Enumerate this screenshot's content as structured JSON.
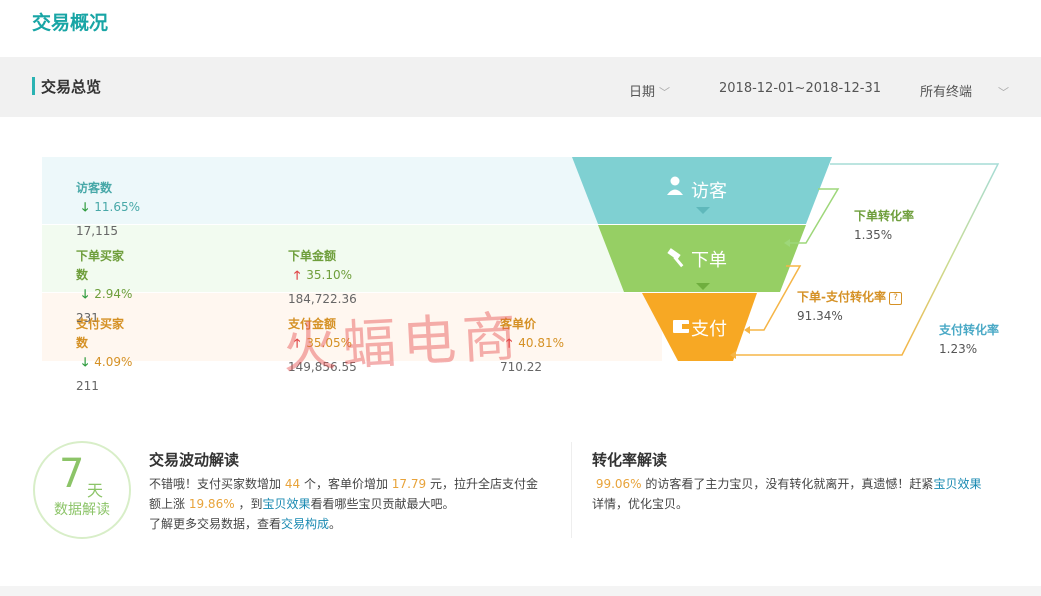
{
  "page": {
    "title": "交易概况"
  },
  "overview": {
    "title": "交易总览",
    "filters": {
      "date_label": "日期",
      "date_range": "2018-12-01~2018-12-31",
      "terminal": "所有终端"
    }
  },
  "metrics": {
    "visitors": {
      "label": "访客数",
      "trend": "down",
      "change": "11.65%",
      "value": "17,115"
    },
    "order_buyers": {
      "label": "下单买家数",
      "trend": "down",
      "change": "2.94%",
      "value": "231"
    },
    "order_amount": {
      "label": "下单金额",
      "trend": "up",
      "change": "35.10%",
      "value": "184,722.36"
    },
    "pay_buyers": {
      "label": "支付买家数",
      "trend": "down",
      "change": "4.09%",
      "value": "211"
    },
    "pay_amount": {
      "label": "支付金额",
      "trend": "up",
      "change": "35.05%",
      "value": "149,856.55"
    },
    "unit_price": {
      "label": "客单价",
      "trend": "up",
      "change": "40.81%",
      "value": "710.22"
    }
  },
  "funnel": {
    "stages": [
      {
        "name": "访客",
        "icon": "user-icon",
        "color": "#7fd0d2"
      },
      {
        "name": "下单",
        "icon": "gavel-icon",
        "color": "#96cf64"
      },
      {
        "name": "支付",
        "icon": "wallet-icon",
        "color": "#f7a824"
      }
    ],
    "rates": {
      "order_rate": {
        "name": "下单转化率",
        "value": "1.35%"
      },
      "order_pay_rate": {
        "name": "下单-支付转化率",
        "value": "91.34%"
      },
      "pay_rate": {
        "name": "支付转化率",
        "value": "1.23%"
      }
    }
  },
  "watermark": "火蝠电商",
  "badge": {
    "days": "7",
    "unit": "天",
    "caption": "数据解读"
  },
  "fluctuation": {
    "title": "交易波动解读",
    "p1_a": "不错哦！支付买家数增加",
    "p1_b": "44",
    "p1_c": "个，客单价增加",
    "p1_d": "17.79",
    "p1_e": "元，拉升全店支付金",
    "p2_a": "额上涨",
    "p2_b": "19.86%",
    "p2_c": "，到",
    "p2_link": "宝贝效果",
    "p2_d": "看看哪些宝贝贡献最大吧。",
    "p3_a": "了解更多交易数据，查看",
    "p3_link": "交易构成",
    "p3_b": "。"
  },
  "conversion": {
    "title": "转化率解读",
    "p1_a": "99.06%",
    "p1_b": "的访客看了主力宝贝，没有转化就离开，真遗憾！赶紧",
    "p1_link": "宝贝效果",
    "p2": "详情，优化宝贝。"
  },
  "colors": {
    "brand": "#18a5a5",
    "highlight": "#e8a33a",
    "link": "#1a8ab2"
  }
}
